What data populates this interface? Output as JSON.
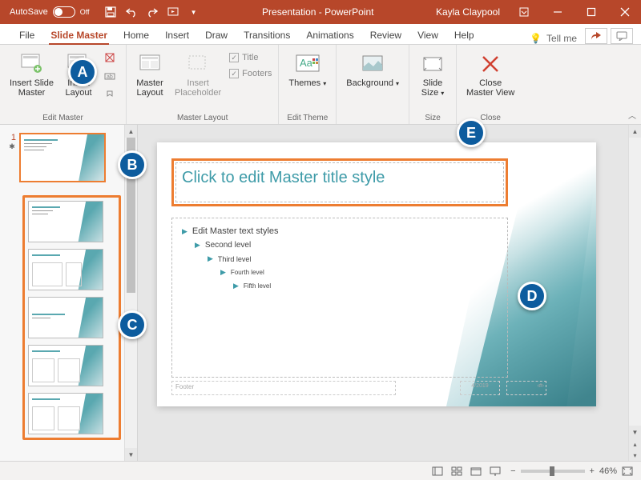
{
  "titleBar": {
    "autosave": "AutoSave",
    "autosaveState": "Off",
    "docTitle": "Presentation - PowerPoint",
    "user": "Kayla Claypool"
  },
  "tabs": {
    "file": "File",
    "slideMaster": "Slide Master",
    "home": "Home",
    "insert": "Insert",
    "draw": "Draw",
    "transitions": "Transitions",
    "animations": "Animations",
    "review": "Review",
    "view": "View",
    "help": "Help",
    "tellMe": "Tell me"
  },
  "ribbon": {
    "insertSlideMaster": "Insert Slide\nMaster",
    "insertLayout": "Insert\nLayout",
    "editMasterGroup": "Edit Master",
    "masterLayout": "Master\nLayout",
    "insertPlaceholder": "Insert\nPlaceholder",
    "titleChk": "Title",
    "footersChk": "Footers",
    "masterLayoutGroup": "Master Layout",
    "themes": "Themes",
    "editThemeGroup": "Edit Theme",
    "background": "Background",
    "slideSize": "Slide\nSize",
    "sizeGroup": "Size",
    "closeMaster": "Close\nMaster View",
    "closeGroup": "Close"
  },
  "thumbs": {
    "masterIndex": "1"
  },
  "slide": {
    "titlePlaceholder": "Click to edit Master title style",
    "bodyL1": "Edit Master text styles",
    "bodyL2": "Second level",
    "bodyL3": "Third level",
    "bodyL4": "Fourth level",
    "bodyL5": "Fifth level",
    "footer": "Footer",
    "date": "4/2019",
    "num": "‹#›"
  },
  "status": {
    "zoomPct": "46%"
  },
  "callouts": {
    "a": "A",
    "b": "B",
    "c": "C",
    "d": "D",
    "e": "E"
  }
}
